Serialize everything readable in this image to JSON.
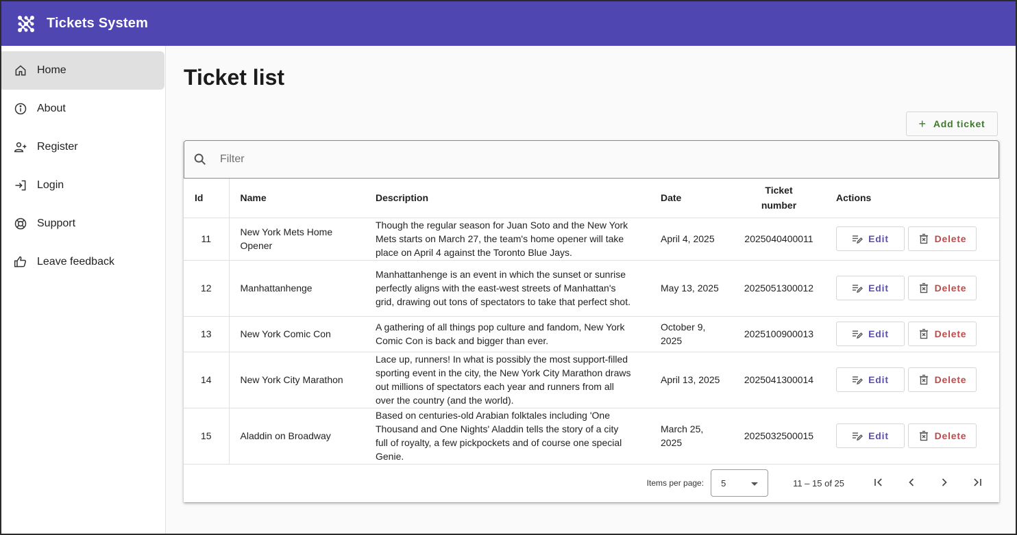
{
  "app": {
    "title": "Tickets System",
    "brand_color": "#4f46b1"
  },
  "sidebar": {
    "items": [
      {
        "label": "Home",
        "icon": "home-icon",
        "active": true
      },
      {
        "label": "About",
        "icon": "info-icon",
        "active": false
      },
      {
        "label": "Register",
        "icon": "person-add-icon",
        "active": false
      },
      {
        "label": "Login",
        "icon": "login-icon",
        "active": false
      },
      {
        "label": "Support",
        "icon": "lifebuoy-icon",
        "active": false
      },
      {
        "label": "Leave feedback",
        "icon": "thumb-up-icon",
        "active": false
      }
    ]
  },
  "page": {
    "title": "Ticket list"
  },
  "toolbar": {
    "add_label": "Add ticket",
    "add_icon": "plus-icon"
  },
  "filter": {
    "placeholder": "Filter",
    "value": ""
  },
  "table": {
    "headers": {
      "id": "Id",
      "name": "Name",
      "description": "Description",
      "date": "Date",
      "ticket_number_1": "Ticket",
      "ticket_number_2": "number",
      "actions": "Actions"
    },
    "edit_label": "Edit",
    "delete_label": "Delete",
    "rows": [
      {
        "id": "11",
        "name": "New York Mets Home Opener",
        "description": "Though the regular season for Juan Soto and the New York Mets starts on March 27, the team's home opener will take place on April 4 against the Toronto Blue Jays.",
        "date": "April 4, 2025",
        "ticket_number": "2025040400011"
      },
      {
        "id": "12",
        "name": "Manhattanhenge",
        "description": "Manhattanhenge is an event in which the sunset or sunrise perfectly aligns with the east-west streets of Manhattan's grid, drawing out tons of spectators to take that perfect shot.",
        "date": "May 13, 2025",
        "ticket_number": "2025051300012"
      },
      {
        "id": "13",
        "name": "New York Comic Con",
        "description": "A gathering of all things pop culture and fandom, New York Comic Con is back and bigger than ever.",
        "date": "October 9, 2025",
        "ticket_number": "2025100900013"
      },
      {
        "id": "14",
        "name": "New York City Marathon",
        "description": "Lace up, runners! In what is possibly the most support-filled sporting event in the city, the New York City Marathon draws out millions of spectators each year and runners from all over the country (and the world).",
        "date": "April 13, 2025",
        "ticket_number": "2025041300014"
      },
      {
        "id": "15",
        "name": "Aladdin on Broadway",
        "description": "Based on centuries-old Arabian folktales including 'One Thousand and One Nights' Aladdin tells the story of a city full of royalty, a few pickpockets and of course one special Genie.",
        "date": "March 25, 2025",
        "ticket_number": "2025032500015"
      }
    ]
  },
  "paginator": {
    "items_per_page_label": "Items per page:",
    "page_size": "5",
    "range": "11 – 15 of 25"
  }
}
